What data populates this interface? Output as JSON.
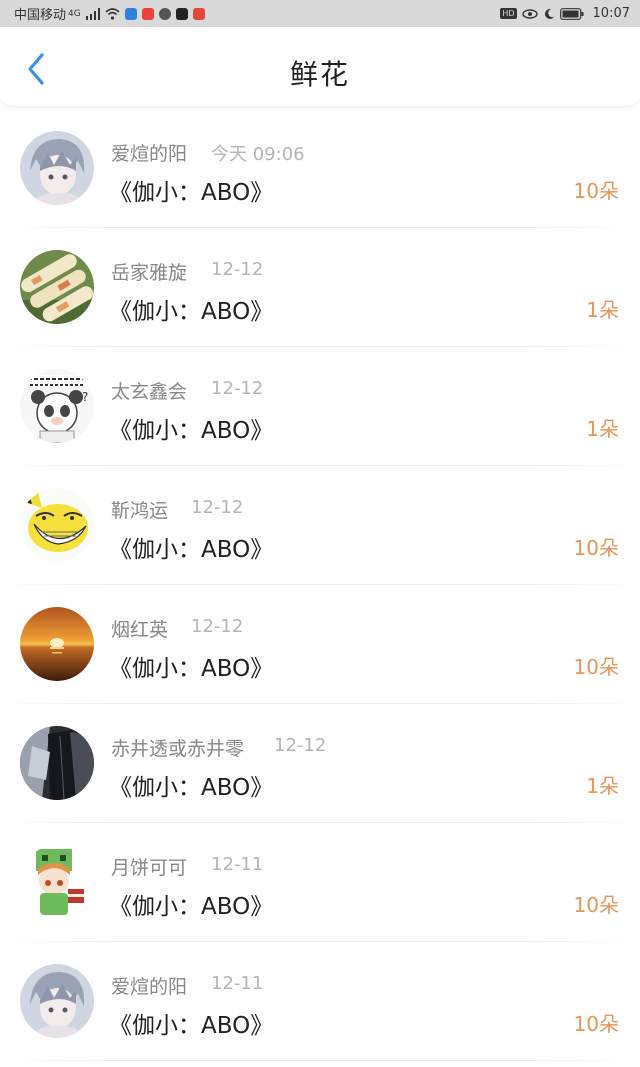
{
  "status_bar": {
    "carrier": "中国移动",
    "network": "4G",
    "time": "10:07",
    "icons": [
      "signal-icon",
      "wifi-icon",
      "shield-app-icon",
      "red-app-icon",
      "wechat-icon",
      "tiktok-icon",
      "red-square-app-icon",
      "hd-icon",
      "eye-icon",
      "moon-icon",
      "battery-icon"
    ]
  },
  "header": {
    "title": "鲜花",
    "back_icon": "chevron-left-icon",
    "accent_color": "#3b8fe8"
  },
  "colors": {
    "count_color": "#e8955a",
    "name_color": "#888888",
    "date_color": "#b5b5b5"
  },
  "entries": [
    {
      "name": "爱煊的阳",
      "date": "今天 09:06",
      "book": "《伽小：ABO》",
      "count": "10朵",
      "avatar": "anime-boy-avatar"
    },
    {
      "name": "岳家雅旋",
      "date": "12-12",
      "book": "《伽小：ABO》",
      "count": "1朵",
      "avatar": "spring-rolls-avatar"
    },
    {
      "name": "太玄鑫会",
      "date": "12-12",
      "book": "《伽小：ABO》",
      "count": "1朵",
      "avatar": "panda-meme-avatar"
    },
    {
      "name": "靳鸿运",
      "date": "12-12",
      "book": "《伽小：ABO》",
      "count": "10朵",
      "avatar": "pikachu-trollface-avatar"
    },
    {
      "name": "烟红英",
      "date": "12-12",
      "book": "《伽小：ABO》",
      "count": "10朵",
      "avatar": "sunset-avatar"
    },
    {
      "name": "赤井透或赤井零",
      "date": "12-12",
      "book": "《伽小：ABO》",
      "count": "1朵",
      "avatar": "dark-clothing-avatar"
    },
    {
      "name": "月饼可可",
      "date": "12-11",
      "book": "《伽小：ABO》",
      "count": "10朵",
      "avatar": "creeper-girl-avatar"
    },
    {
      "name": "爱煊的阳",
      "date": "12-11",
      "book": "《伽小：ABO》",
      "count": "10朵",
      "avatar": "anime-boy-avatar"
    }
  ]
}
